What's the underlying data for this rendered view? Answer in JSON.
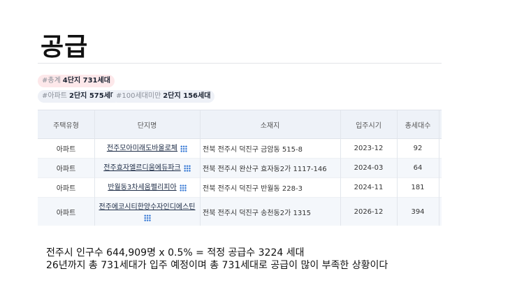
{
  "title": "공급",
  "summary": {
    "total": {
      "label": "#총계",
      "value": "4단지 731세대"
    },
    "apartment": {
      "label": "#아파트",
      "value": "2단지 575세대"
    },
    "under100": {
      "label": "#100세대미만",
      "value": "2단지 156세대"
    }
  },
  "table": {
    "headers": [
      "주택유형",
      "단지명",
      "소재지",
      "입주시기",
      "총세대수"
    ],
    "rows": [
      {
        "type": "아파트",
        "name": "전주모아미래도바울로체",
        "location": "전북 전주시 덕진구 금암동 515-8",
        "date": "2023-12",
        "units": "92"
      },
      {
        "type": "아파트",
        "name": "전주효자엘르디움에듀파크",
        "location": "전북 전주시 완산구 효자동2가 1117-146",
        "date": "2024-03",
        "units": "64"
      },
      {
        "type": "아파트",
        "name": "반월동3차세움펠리피아",
        "location": "전북 전주시 덕진구 반월동 228-3",
        "date": "2024-11",
        "units": "181"
      },
      {
        "type": "아파트",
        "name": "전주에코시티한양수자인디에스틴",
        "location": "전북 전주시 덕진구 송천동2가 1315",
        "date": "2026-12",
        "units": "394"
      }
    ]
  },
  "notes": {
    "line1": "전주시 인구수 644,909명 x 0.5% = 적정 공급수 3224 세대",
    "line2": "26년까지 총 731세대가 입주 예정이며 총 731세대로 공급이 많이 부족한 상황이다"
  },
  "icons": {
    "complex_link": "grid-icon"
  }
}
